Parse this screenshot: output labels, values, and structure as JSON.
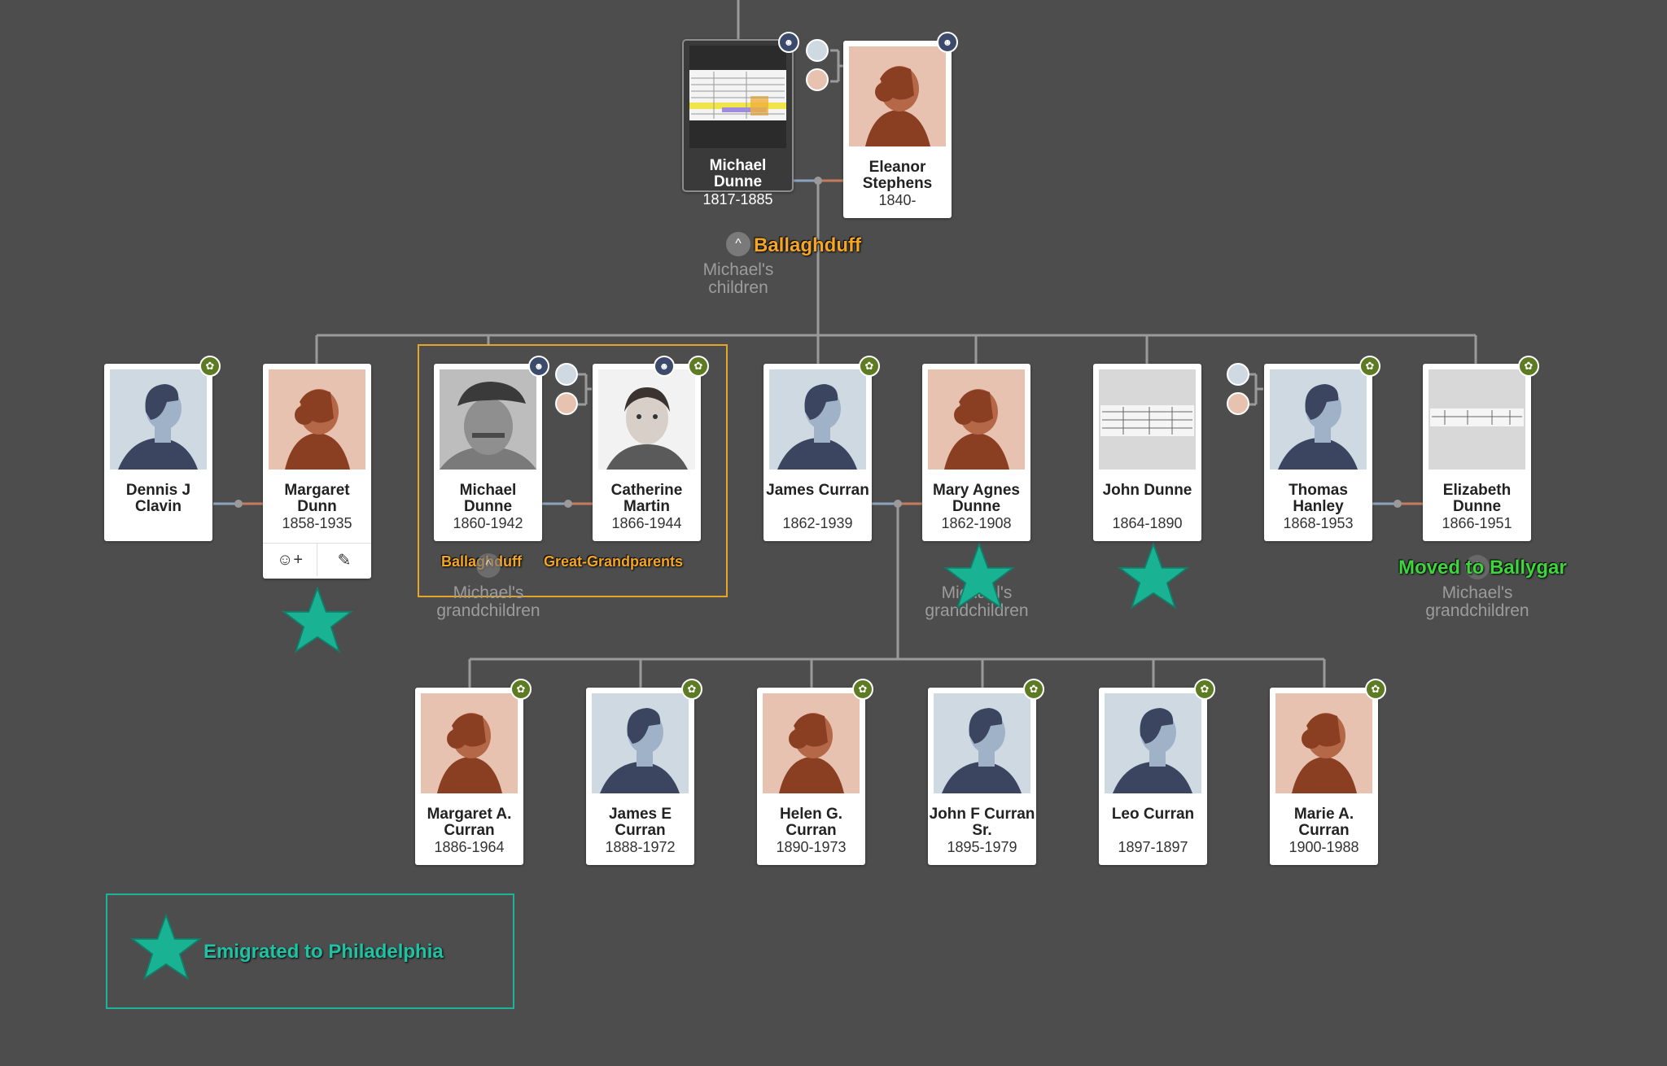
{
  "colors": {
    "background": "#4d4d4d",
    "female_photo": "#e8c2b0",
    "male_photo": "#cfd9e2",
    "hint_green": "#5d7b22",
    "annotation_orange": "#f5a623",
    "annotation_green": "#3dd63d",
    "star_teal": "#19b394"
  },
  "generation1": {
    "michael": {
      "name": "Michael Dunne",
      "dates": "1817-1885"
    },
    "eleanor": {
      "name": "Eleanor Stephens",
      "dates": "1840-"
    },
    "group_label": "Michael's children",
    "annotation": "Ballaghduff"
  },
  "generation2": [
    {
      "id": "dennis",
      "name": "Dennis J Clavin",
      "dates": ""
    },
    {
      "id": "margaret",
      "name": "Margaret Dunn",
      "dates": "1858-1935"
    },
    {
      "id": "michael2",
      "name": "Michael Dunne",
      "dates": "1860-1942"
    },
    {
      "id": "catherine",
      "name": "Catherine Martin",
      "dates": "1866-1944"
    },
    {
      "id": "james",
      "name": "James Curran",
      "dates": "1862-1939"
    },
    {
      "id": "maryagnes",
      "name": "Mary Agnes Dunne",
      "dates": "1862-1908"
    },
    {
      "id": "john",
      "name": "John Dunne",
      "dates": "1864-1890"
    },
    {
      "id": "thomas",
      "name": "Thomas Hanley",
      "dates": "1868-1953"
    },
    {
      "id": "elizabeth",
      "name": "Elizabeth Dunne",
      "dates": "1866-1951"
    }
  ],
  "generation2_labels": {
    "grandchildren_1": "Michael's grandchildren",
    "grandchildren_2": "Michael's grandchildren",
    "grandchildren_3": "Michael's grandchildren",
    "annotation_ballaghduff": "Ballaghduff",
    "annotation_great": "Great-Grandparents",
    "annotation_ballygar": "Moved to Ballygar"
  },
  "generation3": [
    {
      "name": "Margaret A. Curran",
      "dates": "1886-1964"
    },
    {
      "name": "James E Curran",
      "dates": "1888-1972"
    },
    {
      "name": "Helen G. Curran",
      "dates": "1890-1973"
    },
    {
      "name": "John F Curran Sr.",
      "dates": "1895-1979"
    },
    {
      "name": "Leo Curran",
      "dates": "1897-1897"
    },
    {
      "name": "Marie A. Curran",
      "dates": "1900-1988"
    }
  ],
  "legend": {
    "text": "Emigrated to Philadelphia"
  },
  "icons": {
    "hint": "leaf-hint-icon",
    "family": "family-group-icon",
    "collapse": "chevron-up-icon",
    "add_person": "add-person-icon",
    "edit": "pencil-icon",
    "star": "star-icon"
  }
}
